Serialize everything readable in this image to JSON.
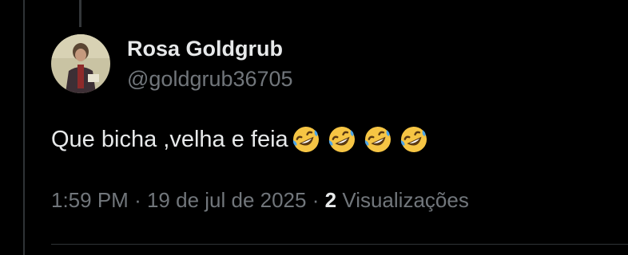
{
  "tweet": {
    "author_name": "Rosa Goldgrub",
    "author_handle": "@goldgrub36705",
    "text": "Que bicha ,velha e feia",
    "emojis": [
      "rolling-on-floor-laughing",
      "rolling-on-floor-laughing",
      "rolling-on-floor-laughing",
      "rolling-on-floor-laughing"
    ],
    "time": "1:59 PM",
    "separator": "·",
    "date": "19 de jul de 2025",
    "views_count": "2",
    "views_label": "Visualizações"
  },
  "colors": {
    "background": "#000000",
    "primary_text": "#e7e9ea",
    "secondary_text": "#71767b",
    "divider": "#2f3336",
    "emoji_face": "#f6c544",
    "emoji_tear": "#4ea6e8"
  }
}
